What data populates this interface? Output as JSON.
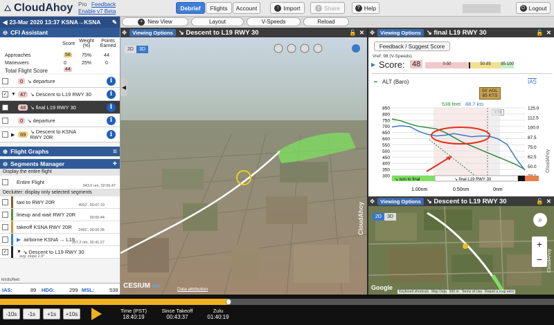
{
  "app": {
    "name": "CloudAhoy",
    "tier": "Pro",
    "feedback": "Feedback",
    "beta": "Enable v7 Beta"
  },
  "nav": {
    "debrief": "Debrief",
    "flights": "Flights",
    "account": "Account",
    "import": "Import",
    "share": "Share",
    "help": "Help",
    "logout": "Logout"
  },
  "toolbar": {
    "new_view": "New View",
    "layout": "Layout",
    "vspeeds": "V-Speeds",
    "reload": "Reload"
  },
  "flight": {
    "date_route": "23-Mar 2020 13:37  KSNA→KSNA"
  },
  "cfi": {
    "title": "CFI Assistant",
    "col_score": "Score",
    "col_weight": "Weight (%)",
    "col_points": "Points Earned",
    "rows": [
      {
        "name": "Approaches",
        "score": "58",
        "weight": "75%",
        "points": "44"
      },
      {
        "name": "Maneuvers",
        "score": "0",
        "weight": "25%",
        "points": "0"
      }
    ],
    "total_label": "Total Flight Score",
    "total": "44"
  },
  "maneuvers": [
    {
      "score": "0",
      "label": "↘ departure",
      "checked": false
    },
    {
      "score": "47",
      "label": "↘ Descent to L19 RWY 30",
      "checked": true
    },
    {
      "score": "48",
      "label": "↘ final L19 RWY 30",
      "checked": true
    },
    {
      "score": "0",
      "label": "↘ departure",
      "checked": false
    },
    {
      "score": "69",
      "label": "↘ Descent to KSNA RWY 20R",
      "checked": false
    }
  ],
  "flight_graphs": "Flight Graphs",
  "segments": {
    "title": "Segments Manager",
    "display_all": "Display the entire flight",
    "entire": {
      "name": "Entire Flight",
      "meta": "343.0 nm, 02:06:47"
    },
    "declutter": "Declutter: display only selected segments",
    "items": [
      {
        "name": "taxi to RWY 20R",
        "meta": "4052', 00:07:19",
        "color": "#8a5a2a"
      },
      {
        "name": "lineup and wait RWY 20R",
        "meta": "00:00:44",
        "color": "#5a8a3a"
      },
      {
        "name": "takeoff KSNA RWY 20R",
        "meta": "2491', 00:00:35",
        "color": "#d88a2a"
      },
      {
        "name": "airborne KSNA → L19",
        "meta": "157.2 nm, 00:41:27",
        "color": "#3a7ad8"
      },
      {
        "name": "↘ Descent to L19 RWY 30",
        "meta": "avg. slope 2.9°",
        "color": "#222"
      }
    ]
  },
  "status": {
    "units": "knots/feet",
    "ias_label": "IAS:",
    "ias": "89",
    "hdg_label": "HDG:",
    "hdg": "299",
    "msl_label": "MSL:",
    "msl": "538"
  },
  "view3d": {
    "options": "Viewing Options",
    "title": "↘ Descent to L19 RWY 30",
    "mode2d": "2D",
    "mode3d": "3D",
    "brand": "CloudAhoy",
    "cesium": "CESIUM",
    "cesium_ion": "ion",
    "attribution": "Data attribution"
  },
  "profile": {
    "options": "Viewing Options",
    "title": "↘ final L19 RWY 30",
    "feedback_btn": "Feedback / Suggest Score",
    "vref": "Vref: 98 (V-Speeds)",
    "score_label": "Score:",
    "score": "48",
    "scale": [
      "0-50",
      "50-85",
      "85-100"
    ],
    "alt_label": "ALT (Baro)",
    "ias_label": "IAS",
    "callout_agl": "50' AGL",
    "callout_kts": "85 KTS",
    "feet": "538 feet",
    "kts": "88.7 kts",
    "info": "Info",
    "turn_label": "↘ turn to final",
    "final_label": "↘ final L19 RWY 30",
    "x_ticks": [
      "1.00nm",
      "0.50nm",
      "0nm"
    ],
    "brand": "CloudAhoy"
  },
  "chart_data": {
    "type": "line",
    "title": "",
    "xlabel": "",
    "ylabel": "",
    "x_ticks": [
      "1.00nm",
      "0.50nm",
      "0nm"
    ],
    "ylim_left": [
      300,
      850
    ],
    "y_ticks_left": [
      850,
      800,
      750,
      700,
      650,
      600,
      550,
      500,
      450,
      400,
      350,
      300
    ],
    "ylim_right": [
      38.1,
      125.0
    ],
    "y_ticks_right": [
      125.0,
      112.5,
      100.0,
      87.5,
      75.0,
      62.5,
      50.0,
      38.1
    ],
    "series": [
      {
        "name": "ALT (Baro)",
        "color": "#2a8a3a",
        "values": [
          760,
          745,
          720,
          700,
          690,
          680,
          650,
          610,
          570,
          540,
          510,
          480,
          450,
          420,
          390,
          350
        ]
      },
      {
        "name": "IAS",
        "color": "#3a78c8",
        "values": [
          100.5,
          102,
          101,
          95,
          91,
          89,
          90,
          92,
          90,
          88,
          89,
          88.7,
          85,
          78,
          60,
          45
        ]
      }
    ],
    "legend": "top"
  },
  "map": {
    "options": "Viewing Options",
    "title": "↘ Descent to L19 RWY 30",
    "mode2d": "2D",
    "mode3d": "3D",
    "google": "Google",
    "attrib": [
      "Keyboard shortcuts",
      "Map Data",
      "500 m",
      "Terms of Use",
      "Report a map error"
    ],
    "brand": "CloudAhoy"
  },
  "playback": {
    "b1": "-10s",
    "b2": "-1s",
    "b3": "+1s",
    "b4": "+10s",
    "time_label": "Time (PST)",
    "time": "18:40:19",
    "since_label": "Since Takeoff",
    "since": "00:43:37",
    "zulu_label": "Zulu",
    "zulu": "01:40:19"
  }
}
